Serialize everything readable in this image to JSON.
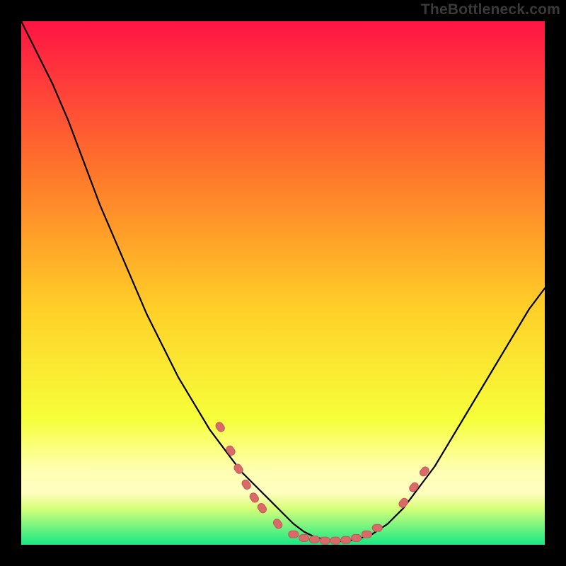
{
  "watermark": "TheBottleneck.com",
  "colors": {
    "frame": "#000000",
    "curve": "#000000",
    "marker_fill": "#d86a6a",
    "marker_stroke": "#c85858",
    "grad_top": "#ff1444",
    "grad_upper_mid": "#ff6a2f",
    "grad_mid": "#ffd028",
    "grad_lower_mid": "#f6ff3a",
    "grad_band": "#fffec0",
    "grad_bottom": "#17e884"
  },
  "chart_data": {
    "type": "line",
    "title": "",
    "xlabel": "",
    "ylabel": "",
    "xlim": [
      0,
      100
    ],
    "ylim": [
      0,
      100
    ],
    "x": [
      0,
      3,
      6,
      9,
      12,
      15,
      18,
      21,
      24,
      27,
      30,
      33,
      36,
      39,
      42,
      45,
      48,
      50,
      52,
      54,
      56,
      58,
      60,
      62,
      64,
      67,
      70,
      73,
      76,
      79,
      82,
      85,
      88,
      91,
      94,
      97,
      100
    ],
    "values": [
      100,
      94,
      88,
      81,
      73,
      65,
      58,
      51,
      44,
      38,
      32,
      27,
      22,
      18,
      14,
      11,
      8,
      6,
      4,
      2.5,
      1.5,
      1,
      0.7,
      0.7,
      1,
      2,
      4,
      7,
      11,
      15,
      20,
      25,
      30,
      35,
      40,
      45,
      49
    ],
    "marker_points": [
      {
        "x": 38,
        "y": 22.5
      },
      {
        "x": 40,
        "y": 18
      },
      {
        "x": 41.5,
        "y": 14.5
      },
      {
        "x": 43,
        "y": 11.5
      },
      {
        "x": 44.5,
        "y": 9
      },
      {
        "x": 46,
        "y": 7
      },
      {
        "x": 49,
        "y": 4
      },
      {
        "x": 52,
        "y": 2
      },
      {
        "x": 54,
        "y": 1.3
      },
      {
        "x": 56,
        "y": 1
      },
      {
        "x": 58,
        "y": 0.8
      },
      {
        "x": 60,
        "y": 0.8
      },
      {
        "x": 62,
        "y": 0.9
      },
      {
        "x": 64,
        "y": 1.3
      },
      {
        "x": 66,
        "y": 2
      },
      {
        "x": 68,
        "y": 3.2
      },
      {
        "x": 73,
        "y": 8
      },
      {
        "x": 75,
        "y": 11
      },
      {
        "x": 77,
        "y": 14
      }
    ],
    "legend": [],
    "grid": false
  }
}
